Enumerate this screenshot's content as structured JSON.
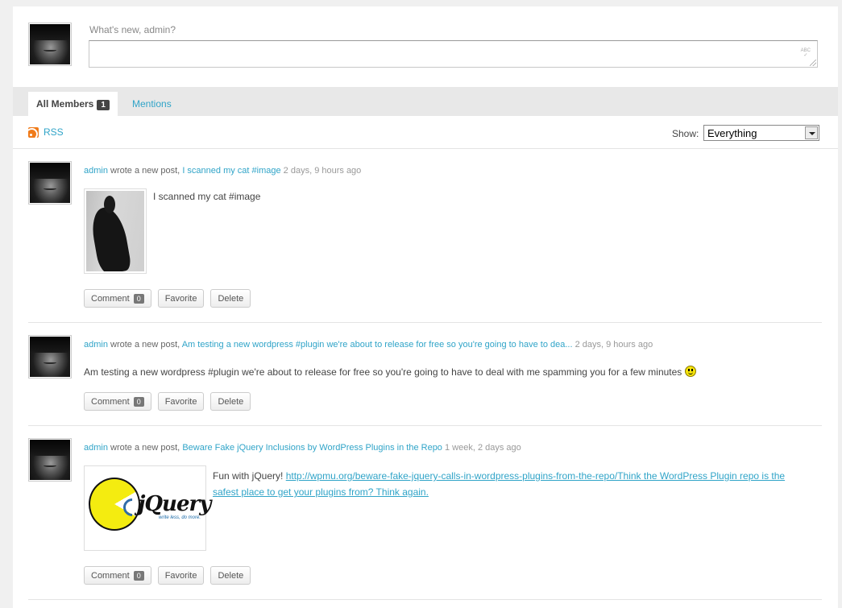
{
  "post_form": {
    "label": "What's new, admin?",
    "value": ""
  },
  "tabs": {
    "all_members": {
      "label": "All Members",
      "count": "1"
    },
    "mentions": {
      "label": "Mentions"
    }
  },
  "filter": {
    "rss_label": "RSS",
    "show_label": "Show:",
    "show_value": "Everything"
  },
  "activities": [
    {
      "user": "admin",
      "action": "wrote a new post,",
      "post_title": "I scanned my cat #image",
      "time": "2 days, 9 hours ago",
      "content": "I scanned my cat #image",
      "comment_label": "Comment",
      "comment_count": "0",
      "favorite_label": "Favorite",
      "delete_label": "Delete"
    },
    {
      "user": "admin",
      "action": "wrote a new post,",
      "post_title": "Am testing a new wordpress #plugin we're about to release for free so you're going to have to dea...",
      "time": "2 days, 9 hours ago",
      "content": "Am testing a new wordpress #plugin we're about to release for free so you're going to have to deal with me spamming you for a few minutes",
      "comment_label": "Comment",
      "comment_count": "0",
      "favorite_label": "Favorite",
      "delete_label": "Delete"
    },
    {
      "user": "admin",
      "action": "wrote a new post,",
      "post_title": "Beware Fake jQuery Inclusions by WordPress Plugins in the Repo",
      "time": "1 week, 2 days ago",
      "content_intro": "Fun with jQuery!",
      "content_link": "http://wpmu.org/beware-fake-jquery-calls-in-wordpress-plugins-from-the-repo/Think the WordPress Plugin repo is the safest place to get your plugins from? Think again.",
      "image_logo_text": "jQuery",
      "image_logo_tagline": "write less, do more.",
      "comment_label": "Comment",
      "comment_count": "0",
      "favorite_label": "Favorite",
      "delete_label": "Delete"
    }
  ]
}
